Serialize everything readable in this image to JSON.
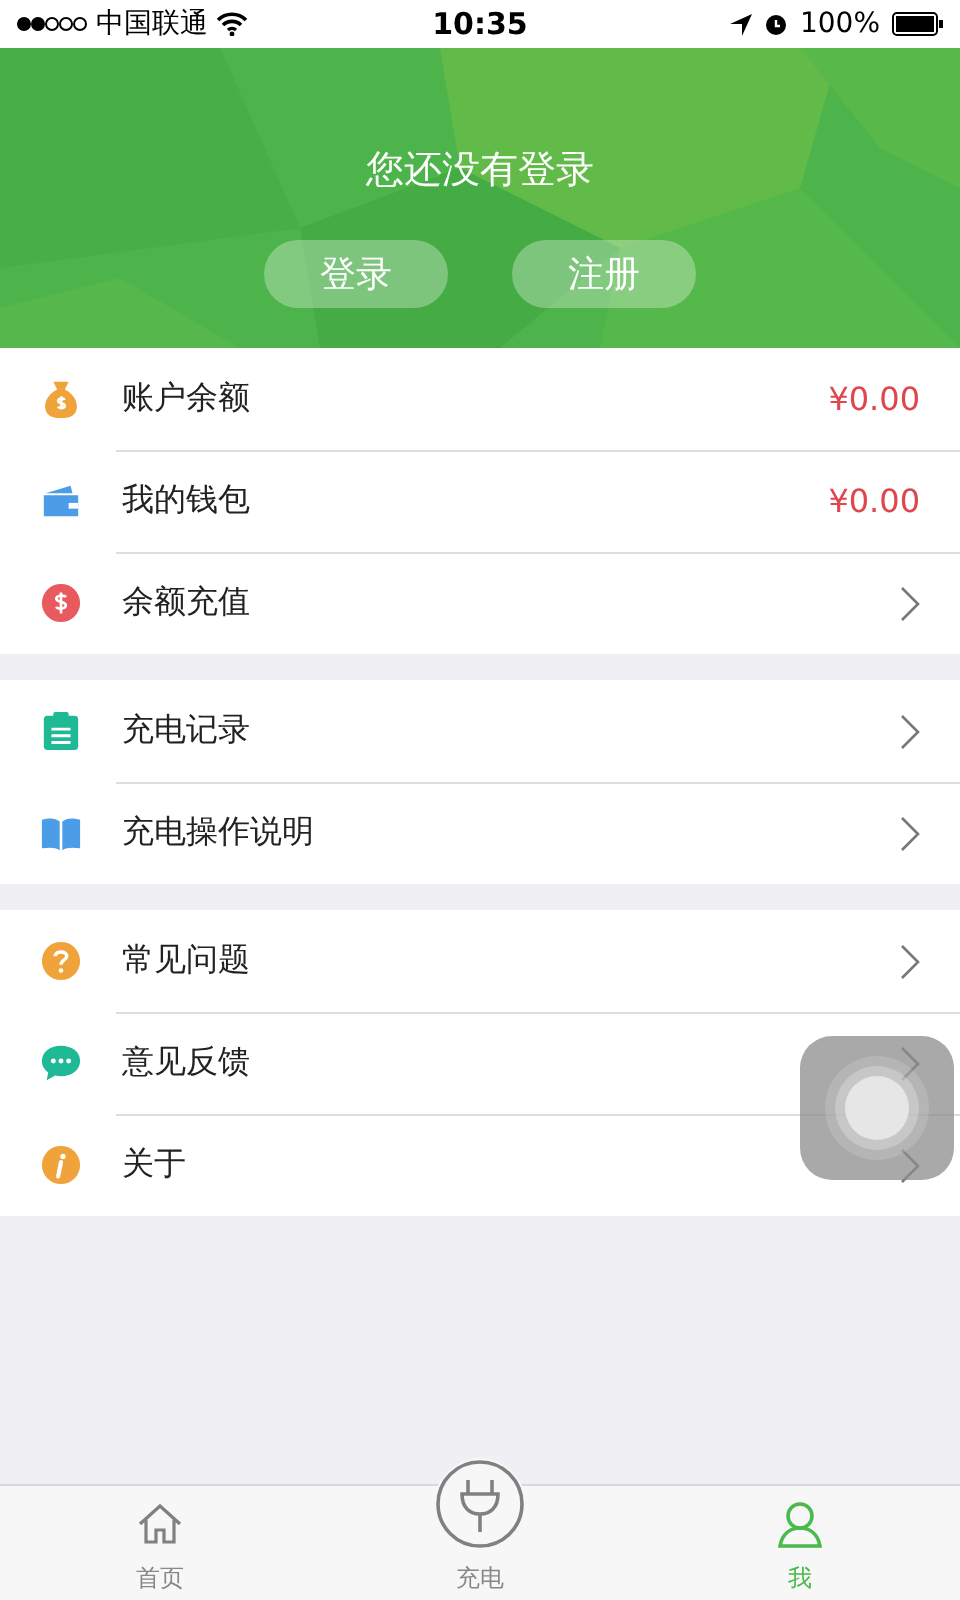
{
  "status_bar": {
    "carrier": "中国联通",
    "time": "10:35",
    "battery": "100%"
  },
  "header": {
    "message": "您还没有登录",
    "buttons": [
      "登录",
      "注册"
    ]
  },
  "sections": [
    {
      "items": [
        {
          "label": "账户余额",
          "kind": "value",
          "value": "¥0.00"
        },
        {
          "label": "我的钱包",
          "kind": "value",
          "value": "¥0.00"
        },
        {
          "label": "余额充值",
          "kind": "link"
        }
      ]
    },
    {
      "items": [
        {
          "label": "充电记录",
          "kind": "link"
        },
        {
          "label": "充电操作说明",
          "kind": "link"
        }
      ]
    },
    {
      "items": [
        {
          "label": "常见问题",
          "kind": "link"
        },
        {
          "label": "意见反馈",
          "kind": "link"
        },
        {
          "label": "关于",
          "kind": "link"
        }
      ]
    }
  ],
  "tab_bar": [
    {
      "label": "首页",
      "selected": false
    },
    {
      "label": "充电",
      "selected": false
    },
    {
      "label": "我",
      "selected": true
    }
  ]
}
